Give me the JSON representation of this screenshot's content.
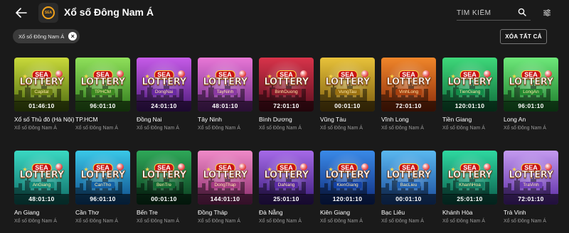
{
  "header": {
    "title": "Xổ số Đông Nam Á",
    "logo_text": "SEA",
    "search_placeholder": "TÌM KIẾM",
    "icons": {
      "back": "arrow-left-icon",
      "search": "search-icon",
      "filter": "sliders-icon"
    }
  },
  "filter_chip": {
    "label": "Xổ số Đông Nam Á"
  },
  "clear_button": {
    "label": "XÓA TẤT CẢ"
  },
  "badge": {
    "sea": "SEA",
    "lottery": "LOTTERY"
  },
  "games": [
    {
      "name": "Xổ số Thủ đô (Hà Nội)",
      "subtitle": "Xổ số Đông Nam Á",
      "province_label": "Capital",
      "timer": "01:46:10",
      "theme": "olive"
    },
    {
      "name": "TP.HCM",
      "subtitle": "Xổ số Đông Nam Á",
      "province_label": "TPHCM",
      "timer": "96:01:10",
      "theme": "lime"
    },
    {
      "name": "Đồng Nai",
      "subtitle": "Xổ số Đông Nam Á",
      "province_label": "DongNai",
      "timer": "24:01:10",
      "theme": "violet"
    },
    {
      "name": "Tây Ninh",
      "subtitle": "Xổ số Đông Nam Á",
      "province_label": "TayNinh",
      "timer": "48:01:10",
      "theme": "pink"
    },
    {
      "name": "Bình Dương",
      "subtitle": "Xổ số Đông Nam Á",
      "province_label": "BinhDuong",
      "timer": "72:01:10",
      "theme": "crimson"
    },
    {
      "name": "Vũng Tàu",
      "subtitle": "Xổ số Đông Nam Á",
      "province_label": "VungTau",
      "timer": "00:01:10",
      "theme": "gold"
    },
    {
      "name": "Vĩnh Long",
      "subtitle": "Xổ số Đông Nam Á",
      "province_label": "VinhLong",
      "timer": "72:01:10",
      "theme": "orange"
    },
    {
      "name": "Tiền Giang",
      "subtitle": "Xổ số Đông Nam Á",
      "province_label": "TienGiang",
      "timer": "120:01:10",
      "theme": "green"
    },
    {
      "name": "Long An",
      "subtitle": "Xổ số Đông Nam Á",
      "province_label": "LongAn",
      "timer": "96:01:10",
      "theme": "green2"
    },
    {
      "name": "An Giang",
      "subtitle": "Xổ số Đông Nam Á",
      "province_label": "AnGiang",
      "timer": "48:01:10",
      "theme": "teal"
    },
    {
      "name": "Cần Thơ",
      "subtitle": "Xổ số Đông Nam Á",
      "province_label": "CanTho",
      "timer": "96:01:10",
      "theme": "cyan"
    },
    {
      "name": "Bến Tre",
      "subtitle": "Xổ số Đông Nam Á",
      "province_label": "BenTre",
      "timer": "00:01:10",
      "theme": "forest"
    },
    {
      "name": "Đồng Tháp",
      "subtitle": "Xổ số Đông Nam Á",
      "province_label": "DongThap",
      "timer": "144:01:10",
      "theme": "rose"
    },
    {
      "name": "Đà Nẵng",
      "subtitle": "Xổ số Đông Nam Á",
      "province_label": "DaNang",
      "timer": "25:01:10",
      "theme": "purple"
    },
    {
      "name": "Kiên Giang",
      "subtitle": "Xổ số Đông Nam Á",
      "province_label": "KienGiang",
      "timer": "120:01:10",
      "theme": "blue"
    },
    {
      "name": "Bạc Liêu",
      "subtitle": "Xổ số Đông Nam Á",
      "province_label": "BacLieu",
      "timer": "00:01:10",
      "theme": "sky"
    },
    {
      "name": "Khánh Hòa",
      "subtitle": "Xổ số Đông Nam Á",
      "province_label": "KhanhHoa",
      "timer": "25:01:10",
      "theme": "emerald"
    },
    {
      "name": "Trà Vinh",
      "subtitle": "Xổ số Đông Nam Á",
      "province_label": "TraVinh",
      "timer": "72:01:10",
      "theme": "lavender"
    }
  ],
  "themes": {
    "olive": {
      "top": "#c9d93a",
      "bottom": "#4b6a10",
      "pill": "#6a7d12"
    },
    "lime": {
      "top": "#8fe05a",
      "bottom": "#2f7a1c",
      "pill": "#3d8a22"
    },
    "violet": {
      "top": "#c65be8",
      "bottom": "#4b1a7a",
      "pill": "#6a2aa3"
    },
    "pink": {
      "top": "#e877d6",
      "bottom": "#6e2a8a",
      "pill": "#8a3aa3"
    },
    "crimson": {
      "top": "#d8334a",
      "bottom": "#5a0e1e",
      "pill": "#8a1a2a"
    },
    "gold": {
      "top": "#e8c23a",
      "bottom": "#7a5a0e",
      "pill": "#9a7010"
    },
    "orange": {
      "top": "#f0862a",
      "bottom": "#8a2a0a",
      "pill": "#a8400e"
    },
    "green": {
      "top": "#3ed87a",
      "bottom": "#0e6a3a",
      "pill": "#138a48"
    },
    "green2": {
      "top": "#6ee87a",
      "bottom": "#1a7a2a",
      "pill": "#228a30"
    },
    "teal": {
      "top": "#3ad8c2",
      "bottom": "#0e6a64",
      "pill": "#138a7a"
    },
    "cyan": {
      "top": "#3ac8e8",
      "bottom": "#0e4a8a",
      "pill": "#1360a3"
    },
    "forest": {
      "top": "#2ea858",
      "bottom": "#0a3a1e",
      "pill": "#136a34"
    },
    "rose": {
      "top": "#f08ac8",
      "bottom": "#8a2a6a",
      "pill": "#a33a80"
    },
    "purple": {
      "top": "#a66ae8",
      "bottom": "#3a1a7a",
      "pill": "#5a2aa3"
    },
    "blue": {
      "top": "#3a8ae8",
      "bottom": "#0e2a7a",
      "pill": "#1340a3"
    },
    "sky": {
      "top": "#5ab8f0",
      "bottom": "#1a4a9a",
      "pill": "#2060b0"
    },
    "emerald": {
      "top": "#2ed8a0",
      "bottom": "#0a5a4a",
      "pill": "#137a60"
    },
    "lavender": {
      "top": "#c49af0",
      "bottom": "#5a2aa3",
      "pill": "#7040b8"
    }
  }
}
